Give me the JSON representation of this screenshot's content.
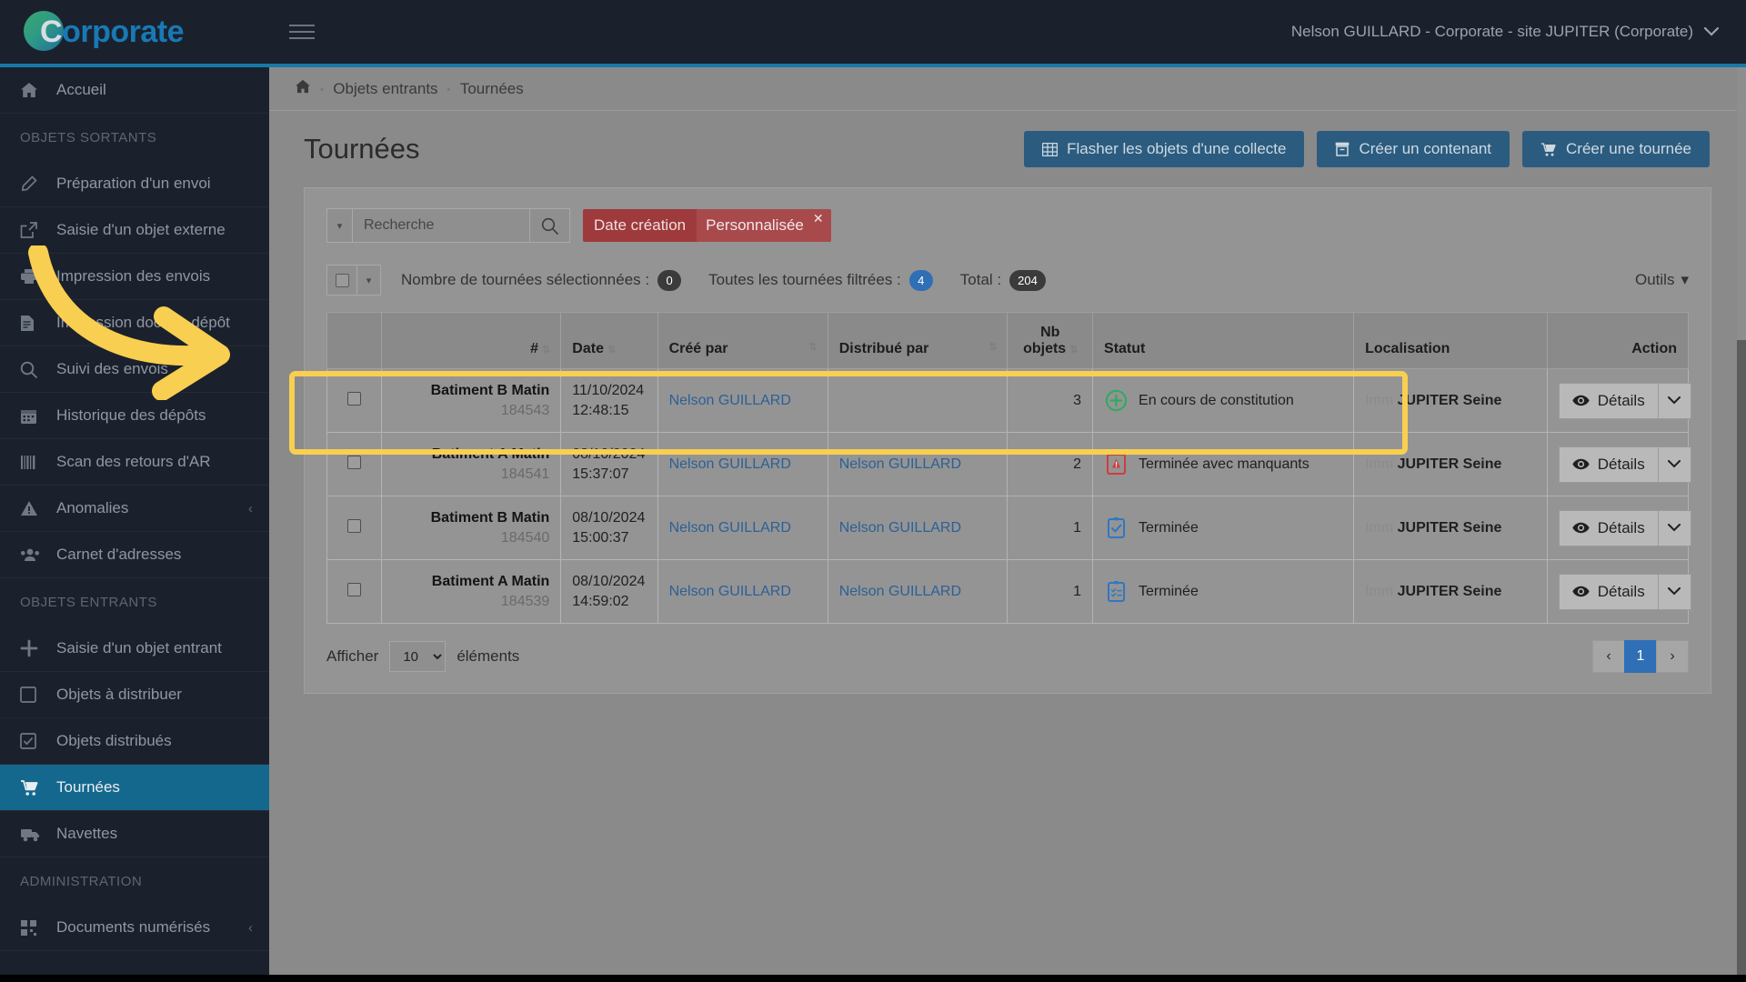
{
  "topbar": {
    "brand_c": "C",
    "brand_rest": "orporate",
    "user_label": "Nelson GUILLARD - Corporate - site JUPITER (Corporate)",
    "menu_icon": "hamburger-icon",
    "caret": "⌄"
  },
  "sidebar": {
    "home": {
      "label": "Accueil",
      "icon": "home-icon"
    },
    "sections": [
      {
        "title": "OBJETS SORTANTS",
        "items": [
          {
            "label": "Préparation d'un envoi",
            "icon": "pencil-icon",
            "chevron": false
          },
          {
            "label": "Saisie d'un objet externe",
            "icon": "external-link-icon",
            "chevron": false
          },
          {
            "label": "Impression des envois",
            "icon": "printer-icon",
            "chevron": false
          },
          {
            "label": "Impression doc. de dépôt",
            "icon": "document-icon",
            "chevron": false
          },
          {
            "label": "Suivi des envois",
            "icon": "search-icon",
            "chevron": false
          },
          {
            "label": "Historique des dépôts",
            "icon": "calendar-icon",
            "chevron": false
          },
          {
            "label": "Scan des retours d'AR",
            "icon": "barcode-icon",
            "chevron": false
          },
          {
            "label": "Anomalies",
            "icon": "warning-icon",
            "chevron": true
          },
          {
            "label": "Carnet d'adresses",
            "icon": "contacts-icon",
            "chevron": false
          }
        ]
      },
      {
        "title": "OBJETS ENTRANTS",
        "items": [
          {
            "label": "Saisie d'un objet entrant",
            "icon": "plus-icon",
            "chevron": false
          },
          {
            "label": "Objets à distribuer",
            "icon": "checkbox-empty-icon",
            "chevron": false
          },
          {
            "label": "Objets distribués",
            "icon": "checkbox-checked-icon",
            "chevron": false
          },
          {
            "label": "Tournées",
            "icon": "cart-icon",
            "chevron": false,
            "active": true
          },
          {
            "label": "Navettes",
            "icon": "truck-icon",
            "chevron": false
          }
        ]
      },
      {
        "title": "ADMINISTRATION",
        "items": [
          {
            "label": "Documents numérisés",
            "icon": "grid-icon",
            "chevron": true
          }
        ]
      }
    ]
  },
  "breadcrumb": {
    "home_icon": "home-icon",
    "items": [
      "Objets entrants",
      "Tournées"
    ]
  },
  "page": {
    "title": "Tournées",
    "actions": [
      {
        "label": "Flasher les objets d'une collecte",
        "icon": "table-icon"
      },
      {
        "label": "Créer un contenant",
        "icon": "box-icon"
      },
      {
        "label": "Créer une tournée",
        "icon": "cart-icon"
      }
    ]
  },
  "filters": {
    "search_placeholder": "Recherche",
    "search_value": "",
    "search_icon": "search-icon",
    "dropdown_caret": "▾",
    "chip": {
      "label": "Date création",
      "value": "Personnalisée",
      "close": "✕"
    }
  },
  "counts": {
    "selected_label": "Nombre de tournées sélectionnées :",
    "selected_value": "0",
    "filtered_label": "Toutes les tournées filtrées :",
    "filtered_value": "4",
    "total_label": "Total :",
    "total_value": "204",
    "tools_label": "Outils",
    "tools_caret": "▾"
  },
  "table": {
    "headers": {
      "check": "",
      "num": "#",
      "date": "Date",
      "creator": "Créé par",
      "distributor": "Distribué par",
      "nb_line1": "Nb",
      "nb_line2": "objets",
      "status": "Statut",
      "location": "Localisation",
      "action": "Action"
    },
    "rows": [
      {
        "name": "Batiment B Matin",
        "id": "184543",
        "date": "11/10/2024",
        "time": "12:48:15",
        "creator": "Nelson GUILLARD",
        "distributor": "",
        "nb": "3",
        "status": "En cours de constitution",
        "status_icon": "plus-circle-icon",
        "status_color": "#2faa62",
        "loc_prefix": "Imm",
        "loc_name": "JUPITER Seine",
        "action_label": "Détails",
        "action_icon": "eye-icon",
        "action_caret": "⌄",
        "highlighted": true
      },
      {
        "name": "Batiment A Matin",
        "id": "184541",
        "date": "08/10/2024",
        "time": "15:37:07",
        "creator": "Nelson GUILLARD",
        "distributor": "Nelson GUILLARD",
        "nb": "2",
        "status": "Terminée avec manquants",
        "status_icon": "alert-square-icon",
        "status_color": "#d23b3b",
        "loc_prefix": "Imm",
        "loc_name": "JUPITER Seine",
        "action_label": "Détails",
        "action_icon": "eye-icon",
        "action_caret": "⌄",
        "highlighted": false
      },
      {
        "name": "Batiment B Matin",
        "id": "184540",
        "date": "08/10/2024",
        "time": "15:00:37",
        "creator": "Nelson GUILLARD",
        "distributor": "Nelson GUILLARD",
        "nb": "1",
        "status": "Terminée",
        "status_icon": "clipboard-check-icon",
        "status_color": "#2f77c4",
        "loc_prefix": "Imm",
        "loc_name": "JUPITER Seine",
        "action_label": "Détails",
        "action_icon": "eye-icon",
        "action_caret": "⌄",
        "highlighted": false
      },
      {
        "name": "Batiment A Matin",
        "id": "184539",
        "date": "08/10/2024",
        "time": "14:59:02",
        "creator": "Nelson GUILLARD",
        "distributor": "Nelson GUILLARD",
        "nb": "1",
        "status": "Terminée",
        "status_icon": "clipboard-list-icon",
        "status_color": "#2f77c4",
        "loc_prefix": "Imm",
        "loc_name": "JUPITER Seine",
        "action_label": "Détails",
        "action_icon": "eye-icon",
        "action_caret": "⌄",
        "highlighted": false
      }
    ]
  },
  "footer": {
    "show_label": "Afficher",
    "page_size": "10",
    "elements_label": "éléments",
    "prev": "‹",
    "page_current": "1",
    "next": "›"
  },
  "colors": {
    "brand_blue": "#1879b5",
    "sidebar_bg": "#1b212c",
    "active_nav": "#15688d",
    "accent_line": "#1679a7",
    "button_blue": "#2b5c80",
    "chip_red": "#9e3a3c",
    "highlight_yellow": "#f8cf50",
    "link_blue": "#2d6096"
  }
}
